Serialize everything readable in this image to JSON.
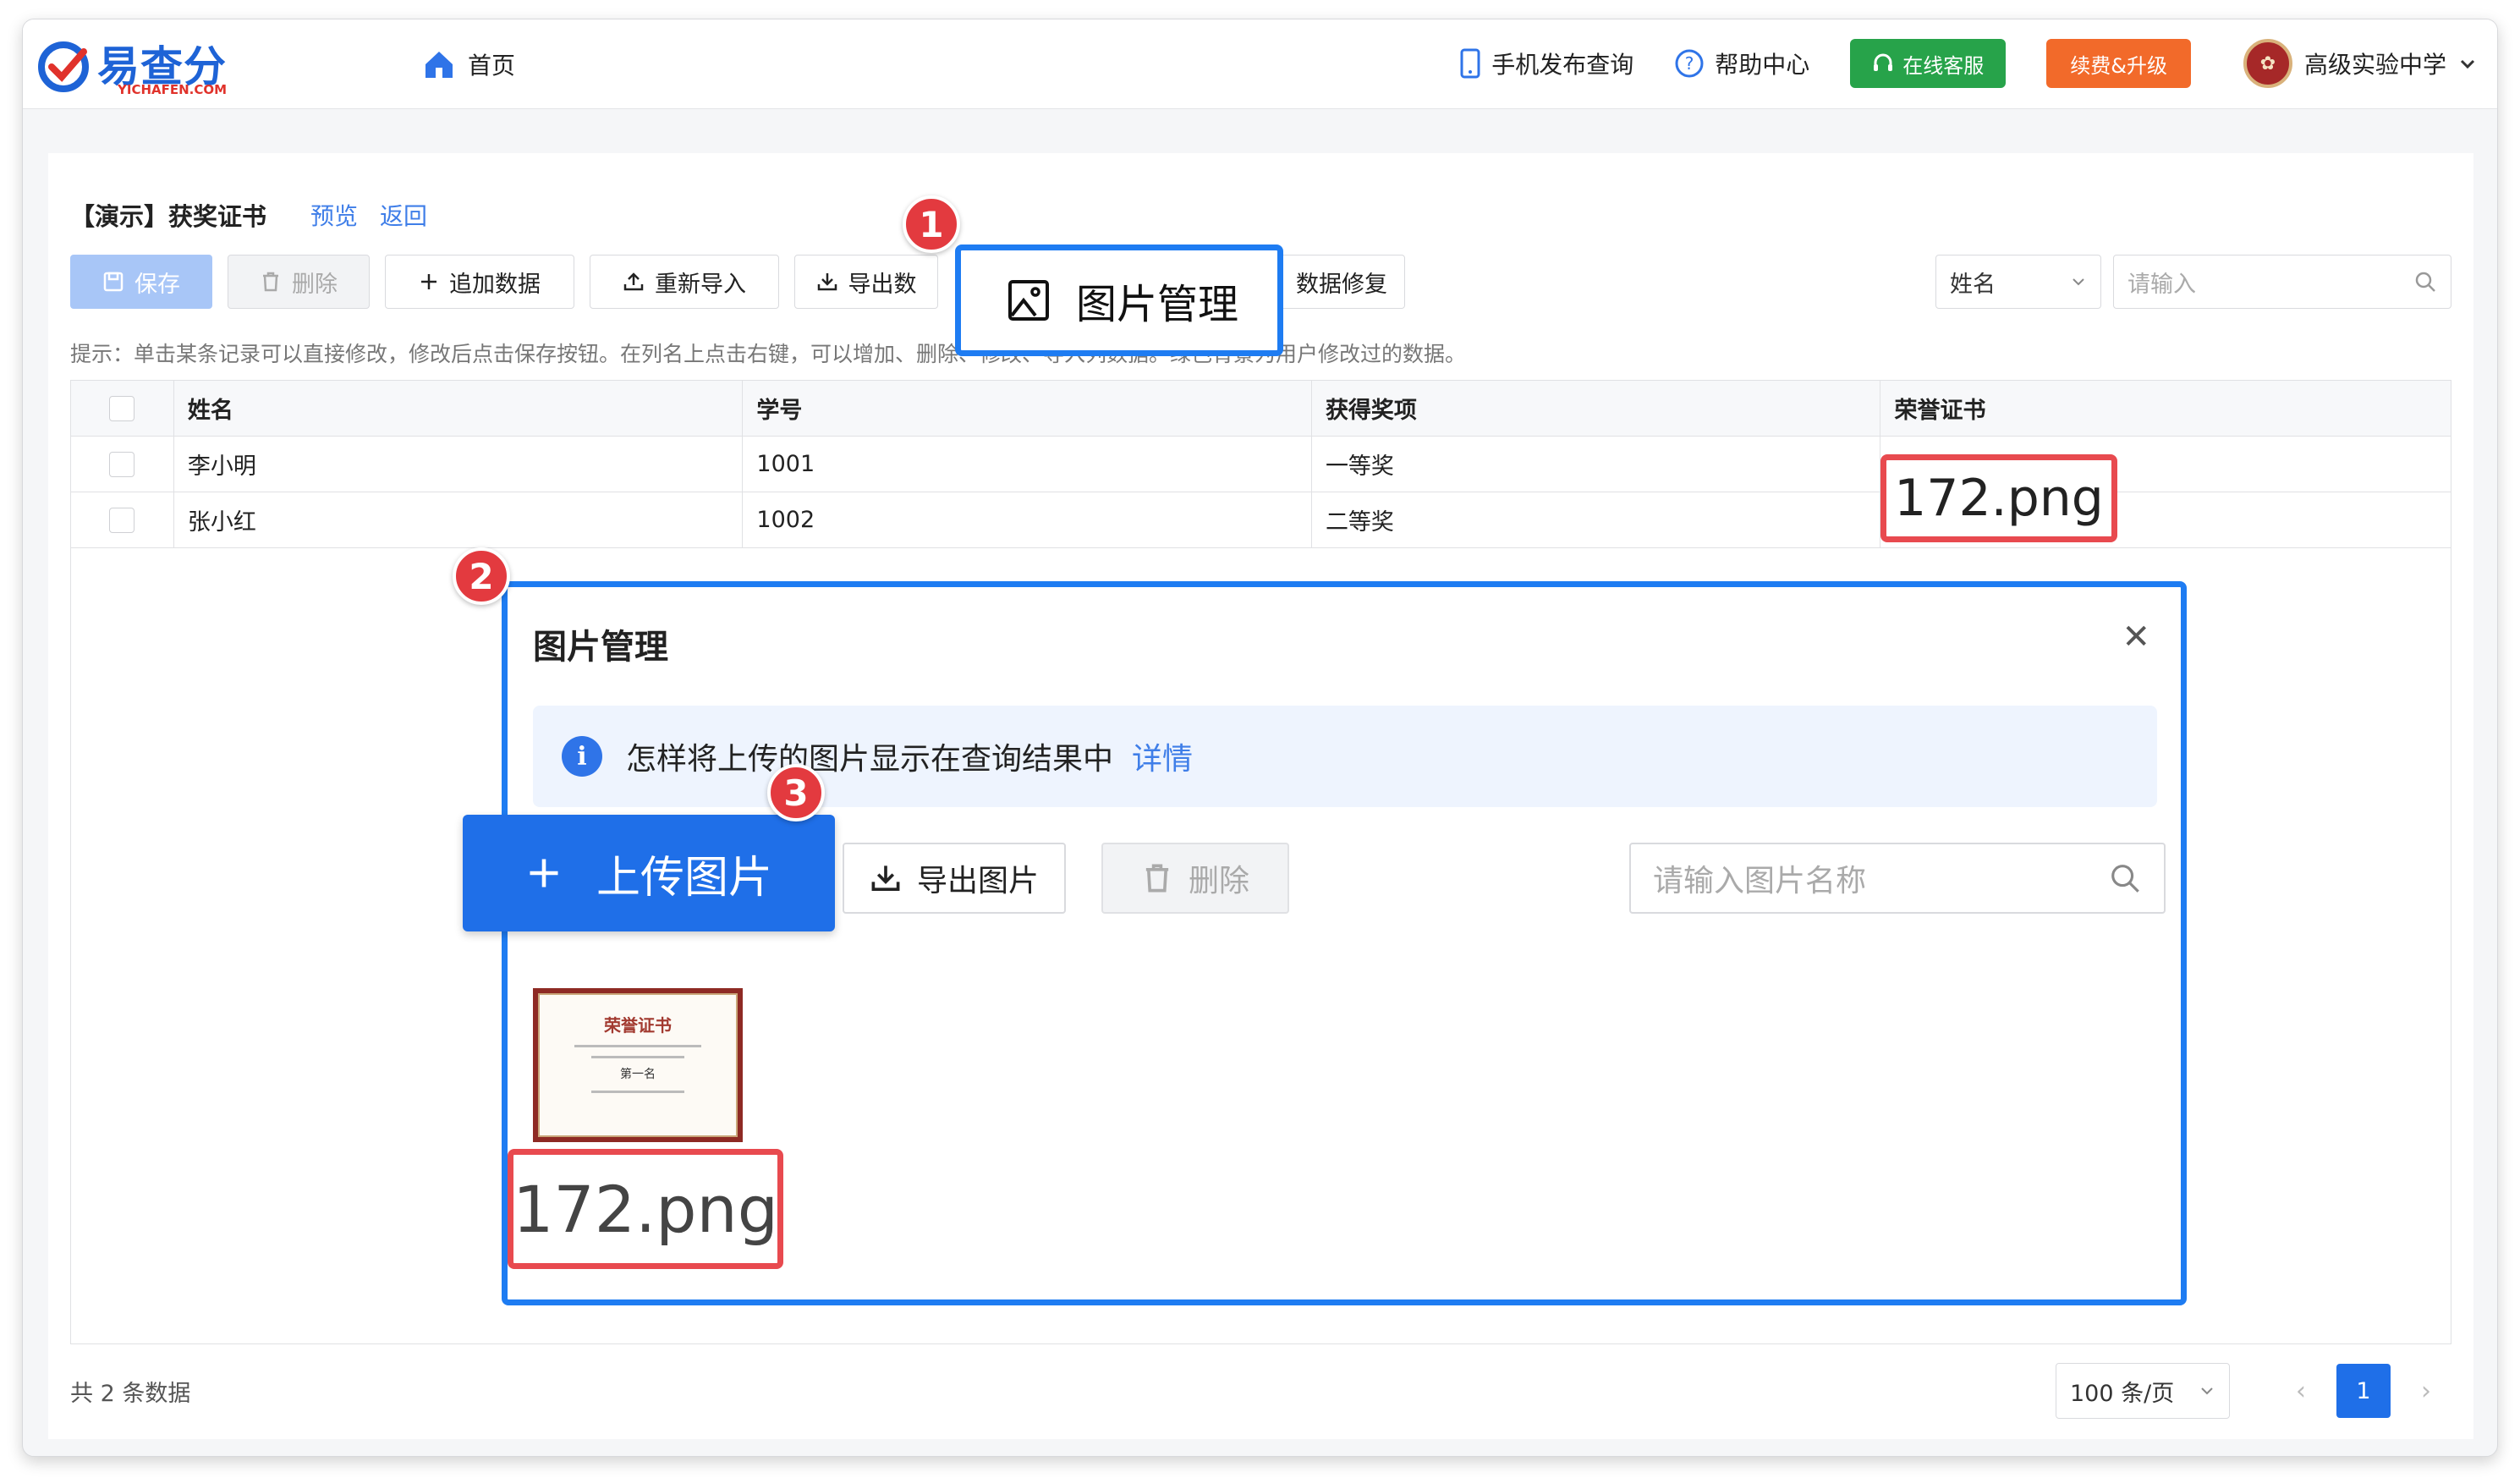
{
  "header": {
    "logo_text": "易查分",
    "logo_sub": "YICHAFEN.COM",
    "home": "首页",
    "mobile_query": "手机发布查询",
    "help": "帮助中心",
    "online_service": "在线客服",
    "renew": "续费&升级",
    "school": "高级实验中学"
  },
  "page": {
    "title": "【演示】获奖证书",
    "preview": "预览",
    "back": "返回",
    "tip": "提示：单击某条记录可以直接修改，修改后点击保存按钮。在列名上点击右键，可以增加、删除、修改、导入列数据。绿色背景为用户修改过的数据。"
  },
  "toolbar": {
    "save": "保存",
    "delete": "删除",
    "add_data": "追加数据",
    "reimport": "重新导入",
    "export": "导出数",
    "repair": "数据修复"
  },
  "search": {
    "field": "姓名",
    "placeholder": "请输入"
  },
  "table": {
    "headers": [
      "姓名",
      "学号",
      "获得奖项",
      "荣誉证书"
    ],
    "rows": [
      [
        "李小明",
        "1001",
        "一等奖",
        "172.png"
      ],
      [
        "张小红",
        "1002",
        "二等奖",
        ""
      ]
    ]
  },
  "footer": {
    "total": "共 2 条数据",
    "page_size": "100 条/页",
    "current_page": "1"
  },
  "callouts": {
    "b1": "1",
    "b2": "2",
    "b3": "3",
    "image_manage": "图片管理",
    "filename": "172.png"
  },
  "modal": {
    "title": "图片管理",
    "info": "怎样将上传的图片显示在查询结果中",
    "detail": "详情",
    "upload": "上传图片",
    "export": "导出图片",
    "delete": "删除",
    "search_placeholder": "请输入图片名称",
    "image_name": "172.png",
    "cert_title": "荣誉证书",
    "cert_rank": "第一名"
  },
  "colors": {
    "primary": "#1f6fe8",
    "callout_blue": "#1e7cf2",
    "callout_red": "#e84a4f",
    "green": "#27a34a",
    "orange": "#f26a2a"
  }
}
